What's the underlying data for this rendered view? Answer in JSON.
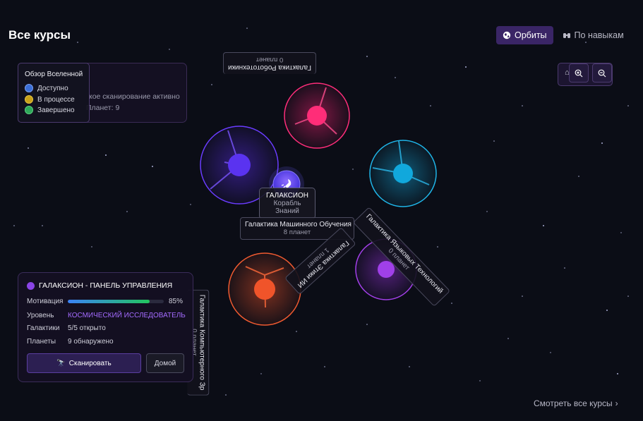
{
  "header": {
    "title": "Все курсы",
    "view_toggle": [
      {
        "label": "Орбиты",
        "icon": "globe-icon",
        "active": true
      },
      {
        "label": "По навыкам",
        "icon": "binoculars-icon",
        "active": false
      }
    ]
  },
  "legend": {
    "title": "Обзор Вселенной",
    "items": [
      {
        "label": "Доступно",
        "color": "#3b6fd8"
      },
      {
        "label": "В процессе",
        "color": "#c9a21a"
      },
      {
        "label": "Завершено",
        "color": "#2fa85a"
      }
    ]
  },
  "status_panel": {
    "line1": "кое сканирование активно",
    "line2": "Планет: 9"
  },
  "zoom": {
    "home_label": "м",
    "zoom_in_icon": "zoom-in-icon",
    "zoom_out_icon": "zoom-out-icon"
  },
  "map": {
    "ship": {
      "title": "ГАЛАКСИОН",
      "subtitle_1": "Корабль",
      "subtitle_2": "Знаний"
    },
    "galaxies": [
      {
        "name": "Галактика Робототехники",
        "count": "0 планет"
      },
      {
        "name": "Галактика Машинного Обучения",
        "count": "8 планет"
      },
      {
        "name": "Галактика Этики ИИ",
        "count": "1 планет"
      },
      {
        "name": "Галактика Языковых Технологий",
        "count": "0 планет"
      },
      {
        "name": "Галактика Компьютерного Зр",
        "count": "0 планет"
      }
    ]
  },
  "dashboard": {
    "title": "ГАЛАКСИОН - ПАНЕЛЬ УПРАВЛЕНИЯ",
    "motivation_label": "Мотивация",
    "motivation_value": 0.85,
    "motivation_pct": "85%",
    "level_label": "Уровень",
    "level_value": "КОСМИЧЕСКИЙ ИССЛЕДОВАТЕЛЬ",
    "galaxies_label": "Галактики",
    "galaxies_value": "5/5 открыто",
    "planets_label": "Планеты",
    "planets_value": "9 обнаружено",
    "scan_button": "Сканировать",
    "home_button": "Домой"
  },
  "footer": {
    "view_all": "Смотреть все курсы"
  },
  "colors": {
    "accent": "#8a44e6",
    "planet_pink": "#e0206a",
    "planet_violet": "#6a35f0",
    "planet_cyan": "#13a6d8",
    "planet_orange": "#f0542a",
    "planet_purple": "#9a33e0"
  }
}
